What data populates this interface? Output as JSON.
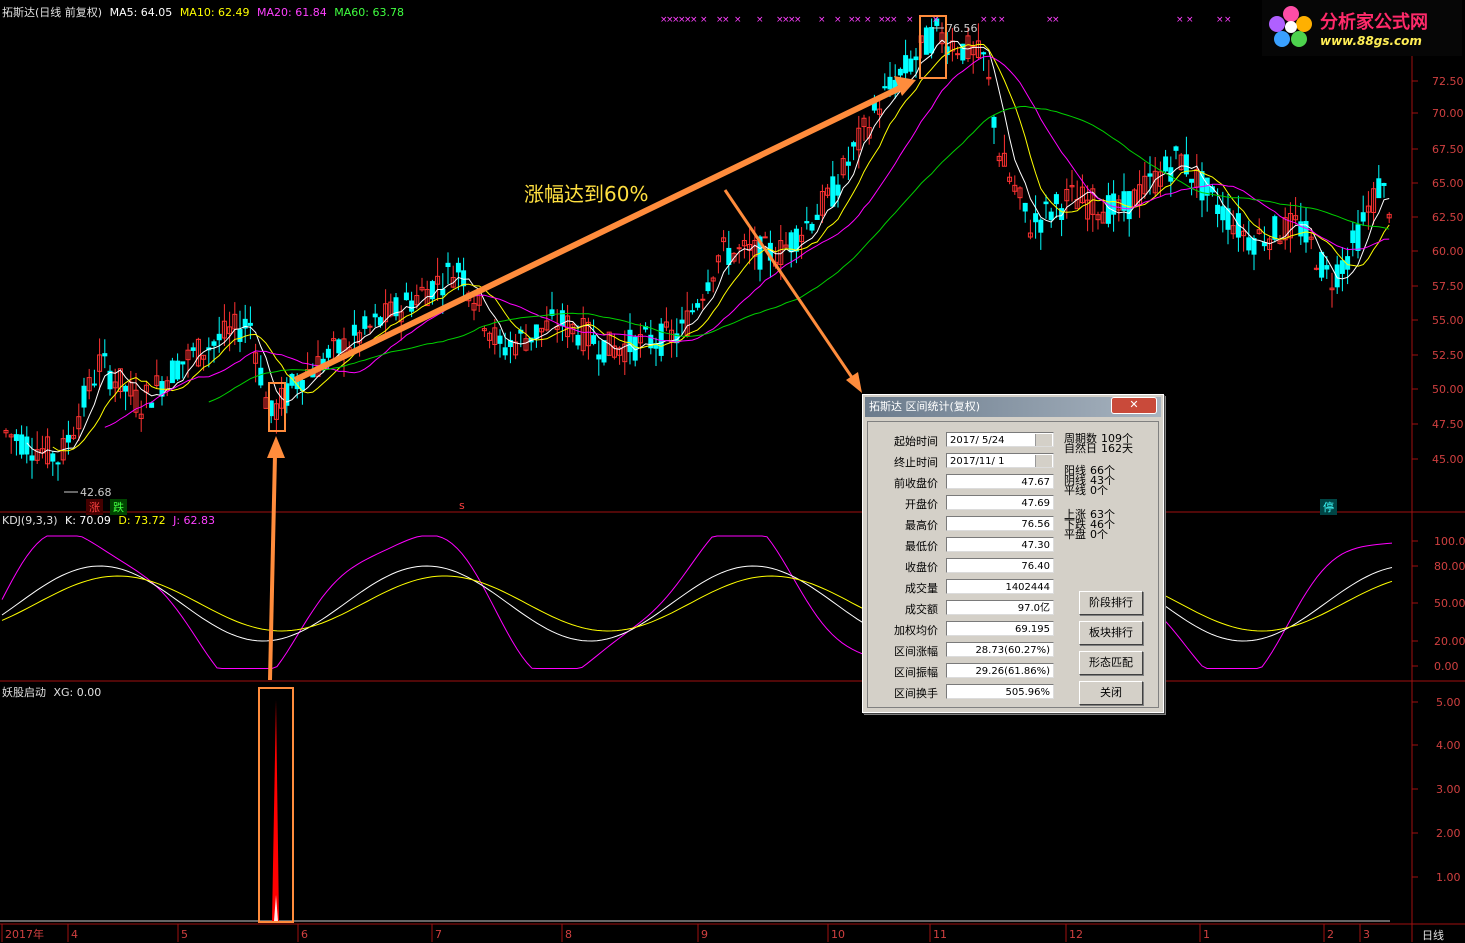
{
  "header": {
    "stock": "拓斯达(日线 前复权)",
    "ma5": "MA5: 64.05",
    "ma10": "MA10: 62.49",
    "ma20": "MA20: 61.84",
    "ma60": "MA60: 63.78"
  },
  "kdj_header": {
    "name": "KDJ(9,3,3)",
    "k": "K: 70.09",
    "d": "D: 73.72",
    "j": "J: 62.83"
  },
  "xg_header": {
    "name": "妖股启动",
    "xg": "XG: 0.00"
  },
  "annotation": "涨幅达到60%",
  "price_markers": {
    "low": "42.68",
    "high": "76.56"
  },
  "tags": [
    "涨",
    "跌",
    "s",
    "停"
  ],
  "price_axis": [
    "72.50",
    "70.00",
    "67.50",
    "65.00",
    "62.50",
    "60.00",
    "57.50",
    "55.00",
    "52.50",
    "50.00",
    "47.50",
    "45.00"
  ],
  "kdj_axis": [
    "100.00",
    "80.00",
    "50.00",
    "20.00",
    "0.00"
  ],
  "xg_axis": [
    "5.00",
    "4.00",
    "3.00",
    "2.00",
    "1.00"
  ],
  "time_axis": [
    "2017年",
    "4",
    "5",
    "6",
    "7",
    "8",
    "9",
    "10",
    "11",
    "12",
    "1",
    "2",
    "3"
  ],
  "period_label": "日线",
  "logo": {
    "title": "分析家公式网",
    "url": "www.88gs.com"
  },
  "colors": {
    "up": "#ff3232",
    "down": "#00ffff",
    "ma5": "#ffffff",
    "ma10": "#ffff00",
    "ma20": "#ff00ff",
    "ma60": "#00ff00",
    "accent": "#ff8c3c"
  },
  "dialog": {
    "title": "拓斯达 区间统计(复权)",
    "close": "关闭",
    "rows": [
      {
        "label": "起始时间",
        "value": "2017/ 5/24"
      },
      {
        "label": "终止时间",
        "value": "2017/11/ 1"
      },
      {
        "label": "前收盘价",
        "value": "47.67"
      },
      {
        "label": "开盘价",
        "value": "47.69"
      },
      {
        "label": "最高价",
        "value": "76.56"
      },
      {
        "label": "最低价",
        "value": "47.30"
      },
      {
        "label": "收盘价",
        "value": "76.40"
      },
      {
        "label": "成交量",
        "value": "1402444"
      },
      {
        "label": "成交额",
        "value": "97.0亿"
      },
      {
        "label": "加权均价",
        "value": "69.195"
      },
      {
        "label": "区间涨幅",
        "value": "28.73(60.27%)"
      },
      {
        "label": "区间振幅",
        "value": "29.26(61.86%)"
      },
      {
        "label": "区间换手",
        "value": "505.96%"
      }
    ],
    "stats": [
      {
        "label": "周期数",
        "value": "109个"
      },
      {
        "label": "自然日",
        "value": "162天"
      },
      {
        "label": "阳线",
        "value": "66个"
      },
      {
        "label": "阴线",
        "value": "43个"
      },
      {
        "label": "平线",
        "value": "0个"
      },
      {
        "label": "上涨",
        "value": "63个"
      },
      {
        "label": "下跌",
        "value": "46个"
      },
      {
        "label": "平盘",
        "value": "0个"
      }
    ],
    "buttons": [
      "阶段排行",
      "板块排行",
      "形态匹配",
      "关闭"
    ]
  }
}
